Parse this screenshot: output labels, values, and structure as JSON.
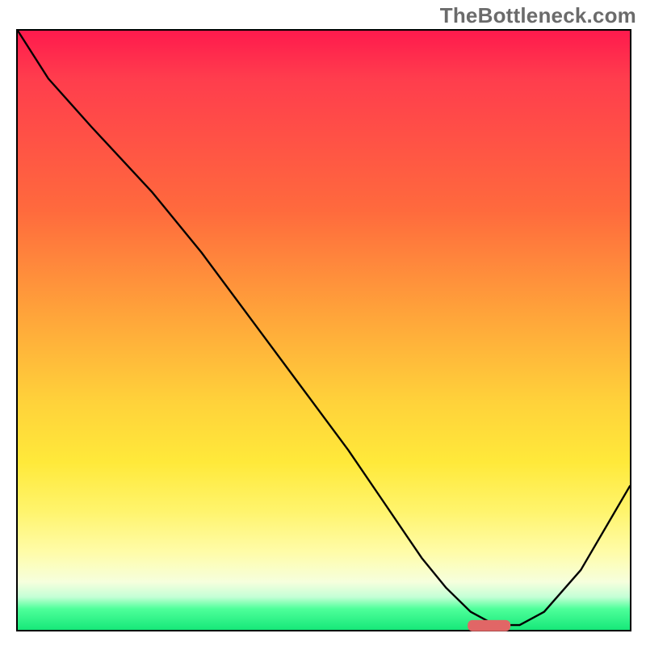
{
  "watermark": "TheBottleneck.com",
  "chart_data": {
    "type": "line",
    "title": "",
    "xlabel": "",
    "ylabel": "",
    "xlim": [
      0,
      100
    ],
    "ylim": [
      0,
      100
    ],
    "grid": false,
    "series": [
      {
        "name": "bottleneck-curve",
        "x": [
          0,
          5,
          12,
          22,
          30,
          38,
          46,
          54,
          60,
          66,
          70,
          74,
          78,
          82,
          86,
          92,
          100
        ],
        "y": [
          100,
          92,
          84,
          73,
          63,
          52,
          41,
          30,
          21,
          12,
          7,
          3,
          0.8,
          0.8,
          3,
          10,
          24
        ]
      }
    ],
    "annotations": [
      {
        "name": "optimal-marker",
        "x_center": 77,
        "y": 0.7,
        "width_pct": 7,
        "color": "#e16666"
      }
    ],
    "gradient_stops": [
      {
        "pct": 0,
        "color": "#ff1a4d"
      },
      {
        "pct": 30,
        "color": "#ff6a3d"
      },
      {
        "pct": 62,
        "color": "#ffd23a"
      },
      {
        "pct": 87,
        "color": "#fffca8"
      },
      {
        "pct": 96.5,
        "color": "#4eff9a"
      },
      {
        "pct": 100,
        "color": "#16e879"
      }
    ]
  }
}
